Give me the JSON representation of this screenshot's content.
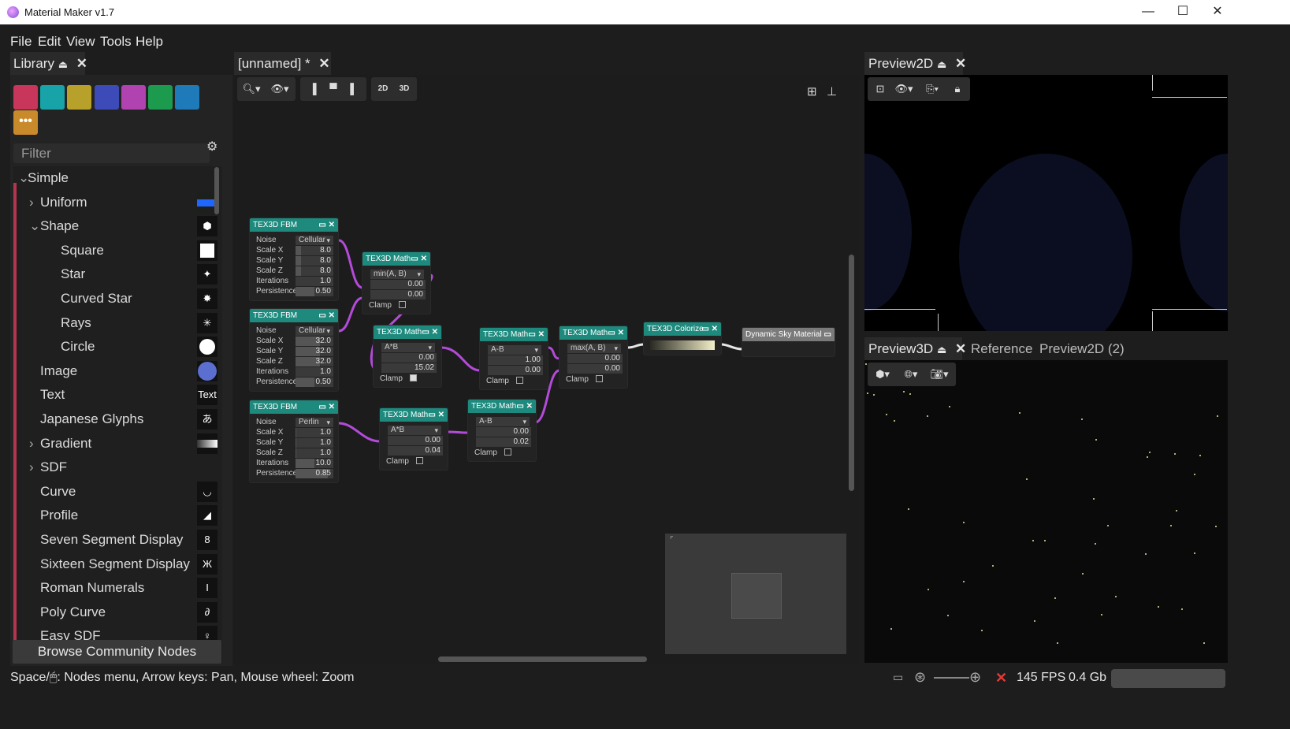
{
  "window": {
    "title": "Material Maker v1.7",
    "controls": [
      "minimize",
      "maximize",
      "close"
    ]
  },
  "menu": [
    "File",
    "Edit",
    "View",
    "Tools",
    "Help"
  ],
  "library": {
    "tab_label": "Library",
    "filter_placeholder": "Filter",
    "categories": [
      {
        "name": "simple-category-icon",
        "color": "#c8365b"
      },
      {
        "name": "3d-category-icon",
        "color": "#18a3a8"
      },
      {
        "name": "pattern-category-icon",
        "color": "#b8a12a"
      },
      {
        "name": "noise-category-icon",
        "color": "#3d4bb8"
      },
      {
        "name": "filter-category-icon",
        "color": "#b043b0"
      },
      {
        "name": "transform-category-icon",
        "color": "#1c9b4e"
      },
      {
        "name": "workflow-category-icon",
        "color": "#1e7ab8"
      },
      {
        "name": "more-category-icon",
        "color": "#c98a2b"
      }
    ],
    "tree": [
      {
        "label": "Simple",
        "indent": 0,
        "arrow": "⌄",
        "icon": ""
      },
      {
        "label": "Uniform",
        "indent": 1,
        "arrow": "›",
        "icon": "uniform"
      },
      {
        "label": "Shape",
        "indent": 1,
        "arrow": "⌄",
        "icon": "hexagon"
      },
      {
        "label": "Square",
        "indent": 2,
        "arrow": "",
        "icon": "square"
      },
      {
        "label": "Star",
        "indent": 2,
        "arrow": "",
        "icon": "star"
      },
      {
        "label": "Curved Star",
        "indent": 2,
        "arrow": "",
        "icon": "curved-star"
      },
      {
        "label": "Rays",
        "indent": 2,
        "arrow": "",
        "icon": "rays"
      },
      {
        "label": "Circle",
        "indent": 2,
        "arrow": "",
        "icon": "circle"
      },
      {
        "label": "Image",
        "indent": 1,
        "arrow": "",
        "icon": "image"
      },
      {
        "label": "Text",
        "indent": 1,
        "arrow": "",
        "icon": "text",
        "icon_text": "Text"
      },
      {
        "label": "Japanese Glyphs",
        "indent": 1,
        "arrow": "",
        "icon": "glyph",
        "icon_text": "あ"
      },
      {
        "label": "Gradient",
        "indent": 1,
        "arrow": "›",
        "icon": "gradient"
      },
      {
        "label": "SDF",
        "indent": 1,
        "arrow": "›",
        "icon": ""
      },
      {
        "label": "Curve",
        "indent": 1,
        "arrow": "",
        "icon": "curve"
      },
      {
        "label": "Profile",
        "indent": 1,
        "arrow": "",
        "icon": "profile"
      },
      {
        "label": "Seven Segment Display",
        "indent": 1,
        "arrow": "",
        "icon": "seven-seg",
        "icon_text": "8"
      },
      {
        "label": "Sixteen Segment Display",
        "indent": 1,
        "arrow": "",
        "icon": "sixteen-seg",
        "icon_text": "Ж"
      },
      {
        "label": "Roman Numerals",
        "indent": 1,
        "arrow": "",
        "icon": "roman",
        "icon_text": "I"
      },
      {
        "label": "Poly Curve",
        "indent": 1,
        "arrow": "",
        "icon": "polycurve",
        "icon_text": "∂"
      },
      {
        "label": "Easy SDF",
        "indent": 1,
        "arrow": "",
        "icon": "easy-sdf",
        "icon_text": "♀"
      }
    ],
    "browse_button": "Browse Community Nodes"
  },
  "graph": {
    "tab_label": "[unnamed] *",
    "toolbar": {
      "mode_2d": "2D",
      "mode_3d": "3D"
    },
    "nodes": [
      {
        "id": "fbm1",
        "title": "TEX3D FBM",
        "noise": "Cellular",
        "params": [
          {
            "label": "Scale X",
            "value": "8.0",
            "fill": 0.15
          },
          {
            "label": "Scale Y",
            "value": "8.0",
            "fill": 0.15
          },
          {
            "label": "Scale Z",
            "value": "8.0",
            "fill": 0.15
          },
          {
            "label": "Iterations",
            "value": "1.0",
            "fill": 0.0
          },
          {
            "label": "Persistence",
            "value": "0.50",
            "fill": 0.5
          }
        ]
      },
      {
        "id": "fbm2",
        "title": "TEX3D FBM",
        "noise": "Cellular",
        "params": [
          {
            "label": "Scale X",
            "value": "32.0",
            "fill": 0.64
          },
          {
            "label": "Scale Y",
            "value": "32.0",
            "fill": 0.64
          },
          {
            "label": "Scale Z",
            "value": "32.0",
            "fill": 0.64
          },
          {
            "label": "Iterations",
            "value": "1.0",
            "fill": 0.0
          },
          {
            "label": "Persistence",
            "value": "0.50",
            "fill": 0.5
          }
        ]
      },
      {
        "id": "fbm3",
        "title": "TEX3D FBM",
        "noise": "Perlin",
        "params": [
          {
            "label": "Scale X",
            "value": "1.0",
            "fill": 0.02
          },
          {
            "label": "Scale Y",
            "value": "1.0",
            "fill": 0.02
          },
          {
            "label": "Scale Z",
            "value": "1.0",
            "fill": 0.02
          },
          {
            "label": "Iterations",
            "value": "10.0",
            "fill": 0.5
          },
          {
            "label": "Persistence",
            "value": "0.85",
            "fill": 0.85
          }
        ]
      },
      {
        "id": "math1",
        "title": "TEX3D Math",
        "op": "min(A, B)",
        "values": [
          "0.00",
          "0.00"
        ],
        "clamp": "Clamp",
        "clamped": false
      },
      {
        "id": "math2",
        "title": "TEX3D Math",
        "op": "A*B",
        "values": [
          "0.00",
          "15.02"
        ],
        "clamp": "Clamp",
        "clamped": true
      },
      {
        "id": "math3",
        "title": "TEX3D Math",
        "op": "A*B",
        "values": [
          "0.00",
          "0.04"
        ],
        "clamp": "Clamp",
        "clamped": false
      },
      {
        "id": "math4",
        "title": "TEX3D Math",
        "op": "A-B",
        "values": [
          "1.00",
          "0.00"
        ],
        "clamp": "Clamp",
        "clamped": false
      },
      {
        "id": "math5",
        "title": "TEX3D Math",
        "op": "A-B",
        "values": [
          "0.00",
          "0.02"
        ],
        "clamp": "Clamp",
        "clamped": false
      },
      {
        "id": "math6",
        "title": "TEX3D Math",
        "op": "max(A, B)",
        "values": [
          "0.00",
          "0.00"
        ],
        "clamp": "Clamp",
        "clamped": false
      },
      {
        "id": "colorize",
        "title": "TEX3D Colorize"
      },
      {
        "id": "output",
        "title": "Dynamic Sky Material"
      }
    ]
  },
  "preview2d": {
    "tab_label": "Preview2D"
  },
  "preview3d": {
    "tabs": [
      "Preview3D",
      "Reference",
      "Preview2D (2)"
    ]
  },
  "status": {
    "hint": "Space/🖱: Nodes menu, Arrow keys: Pan, Mouse wheel: Zoom",
    "fps": "145 FPS",
    "memory": "0.4 Gb"
  },
  "colors": {
    "accent": "#1e8a7e",
    "wire": "#b34bd8",
    "lib_bar": "#b3364e"
  }
}
